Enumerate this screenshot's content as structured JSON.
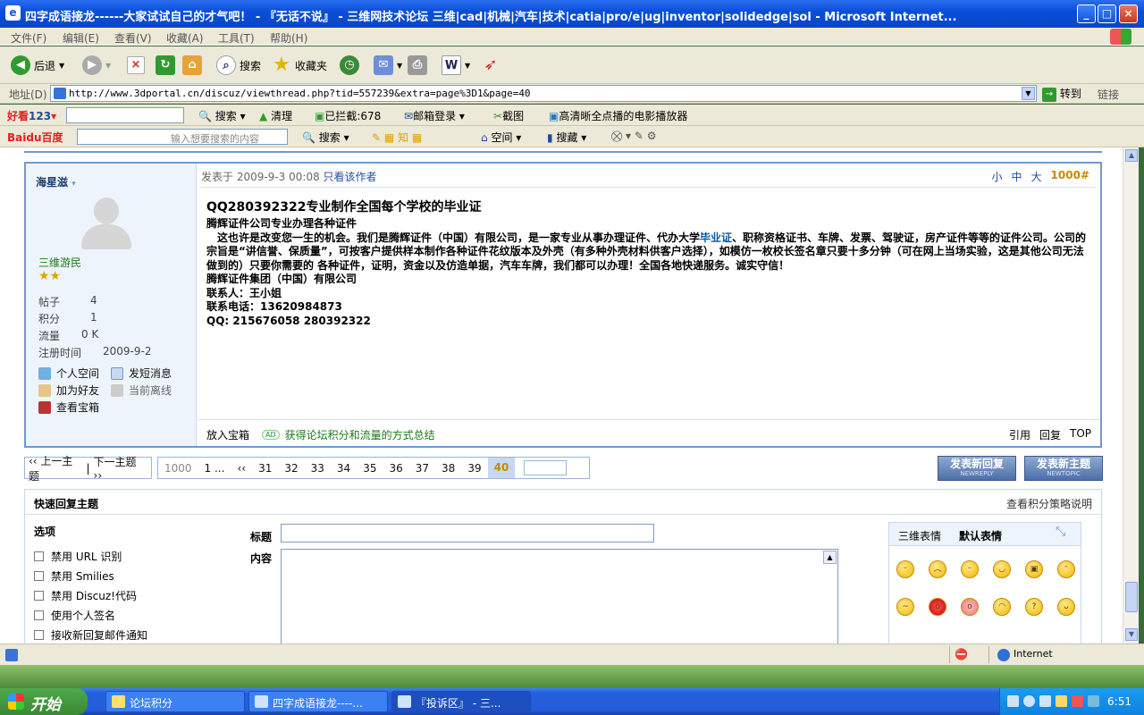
{
  "window": {
    "title": "四字成语接龙------大家试试自己的才气吧！ - 『无话不说』 - 三维网技术论坛 三维|cad|机械|汽车|技术|catia|pro/e|ug|inventor|solidedge|sol - Microsoft Internet...",
    "min": "_",
    "max": "□",
    "close": "×"
  },
  "menu": [
    "文件(F)",
    "编辑(E)",
    "查看(V)",
    "收藏(A)",
    "工具(T)",
    "帮助(H)"
  ],
  "toolbar": {
    "back": "后退",
    "search": "搜索",
    "favorites": "收藏夹"
  },
  "address": {
    "label": "地址(D)",
    "url": "http://www.3dportal.cn/discuz/viewthread.php?tid=557239&extra=page%3D1&page=40",
    "go": "转到",
    "links": "链接"
  },
  "bar3": {
    "hao123": "123",
    "search": "搜索",
    "clean": "清理",
    "blocked": "已拦截:678",
    "mail_login": "邮箱登录",
    "screenshot": "截图",
    "player": "高清晰全点播的电影播放器"
  },
  "baidu": {
    "logo": "Baidu百度",
    "placeholder": "输入想要搜索的内容",
    "search": "搜索",
    "space": "空间",
    "collect": "搜藏"
  },
  "user": {
    "name": "海星滋",
    "group": "三维游民",
    "stars": "★★",
    "rows": [
      {
        "k": "帖子",
        "v": "4"
      },
      {
        "k": "积分",
        "v": "1"
      },
      {
        "k": "流量",
        "v": "0 K"
      },
      {
        "k": "注册时间",
        "v": "2009-9-2"
      }
    ],
    "links": [
      "个人空间",
      "发短消息",
      "加为好友",
      "当前离线",
      "查看宝箱"
    ]
  },
  "post": {
    "posted_label": "发表于",
    "posted_time": "2009-9-3 00:08",
    "author_only": "只看该作者",
    "sizes": [
      "小",
      "中",
      "大"
    ],
    "floor": "1000#",
    "title": "QQ280392322专业制作全国每个学校的毕业证",
    "line1": "腾辉证件公司专业办理各种证件",
    "p1a": "　这也许是改变您一生的机会。我们是腾辉证件（中国）有限公司，是一家专业从事办理证件、代办大学",
    "p1link": "毕业证",
    "p1b": "、职称资格证书、车牌、发票、驾驶证，房产证件等等的证件公司。公司的宗旨是“讲信誉、保质量”，可按客户提供样本制作各种证件花纹版本及外壳（有多种外壳材料供客户选择），如模仿一枚校长签名章只要十多分钟（可在网上当场实验，这是其他公司无法做到的）只要你需要的 各种证件，证明，资金以及仿造单据，汽车车牌，我们都可以办理！全国各地快递服务。诚实守信！",
    "company": "腾辉证件集团（中国）有限公司",
    "contact": "联系人：王小姐",
    "phone": "联系电话：13620984873",
    "qq": "QQ: 215676058  280392322",
    "foot_box": "放入宝箱",
    "foot_ad": "AD",
    "foot_link": "获得论坛积分和流量的方式总结",
    "foot_actions": [
      "引用",
      "回复",
      "TOP"
    ]
  },
  "pager": {
    "prev": "‹‹ 上一主题",
    "next": "下一主题 ››",
    "total": "1000",
    "first": "1 ...",
    "back": "‹‹",
    "pages": [
      "31",
      "32",
      "33",
      "34",
      "35",
      "36",
      "37",
      "38",
      "39"
    ],
    "current": "40"
  },
  "buttons": {
    "new_reply": "发表新回复",
    "new_reply_en": "NEWREPLY",
    "new_topic": "发表新主题",
    "new_topic_en": "NEWTOPIC"
  },
  "quick": {
    "title": "快速回复主题",
    "help": "查看积分策略说明",
    "options_label": "选项",
    "options": [
      "禁用 URL 识别",
      "禁用 Smilies",
      "禁用 Discuz!代码",
      "使用个人签名",
      "接收新回复邮件通知"
    ],
    "subject_label": "标题",
    "content_label": "内容",
    "smiley_tabs": [
      "三维表情",
      "默认表情"
    ]
  },
  "status": {
    "zone": "Internet"
  },
  "taskbar": {
    "start": "开始",
    "tasks": [
      "论坛积分",
      "四字成语接龙----...",
      "『投诉区』 - 三..."
    ],
    "clock": "6:51"
  }
}
